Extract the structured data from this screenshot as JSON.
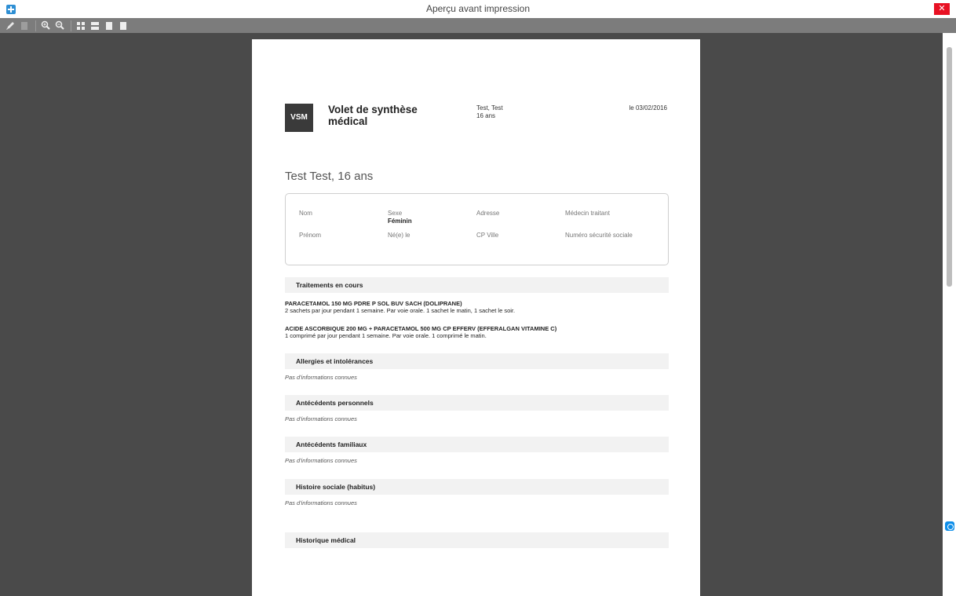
{
  "window": {
    "title": "Aperçu avant impression",
    "close_glyph": "✕"
  },
  "toolbar": {
    "buttons": [
      "pencil-icon",
      "copy-icon",
      "zoom-in-icon",
      "zoom-out-icon",
      "whole-page-icon",
      "page-width-icon",
      "two-pages-icon",
      "single-page-icon"
    ]
  },
  "document": {
    "badge": "VSM",
    "title": "Volet de synthèse médical",
    "patient_name": "Test, Test",
    "patient_age": "16 ans",
    "date": "le 03/02/2016",
    "patient_heading": "Test Test, 16 ans",
    "identity": {
      "nom_label": "Nom",
      "sexe_label": "Sexe",
      "sexe_value": "Féminin",
      "adresse_label": "Adresse",
      "medecin_label": "Médecin traitant",
      "prenom_label": "Prénom",
      "ne_le_label": "Né(e) le",
      "cp_ville_label": "CP Ville",
      "nss_label": "Numéro sécurité sociale"
    },
    "sections": {
      "traitements": {
        "title": "Traitements en cours",
        "meds": [
          {
            "name": "PARACETAMOL 150 mg pdre p sol buv sach (DOLIPRANE)",
            "dosage": "2 sachets par jour pendant 1 semaine. Par voie orale. 1 sachet le matin, 1 sachet le soir."
          },
          {
            "name": "ACIDE ASCORBIQUE 200 mg  +  PARACETAMOL 500 mg cp efferv (EFFERALGAN VITAMINE C)",
            "dosage": "1 comprimé par jour pendant 1 semaine. Par voie orale. 1 comprimé le matin."
          }
        ]
      },
      "allergies": {
        "title": "Allergies et intolérances",
        "empty": "Pas d'informations connues"
      },
      "antecedents_perso": {
        "title": "Antécédents personnels",
        "empty": "Pas d'informations connues"
      },
      "antecedents_fam": {
        "title": "Antécédents familiaux",
        "empty": "Pas d'informations connues"
      },
      "histoire_sociale": {
        "title": "Histoire sociale (habitus)",
        "empty": "Pas d'informations connues"
      },
      "historique": {
        "title": "Historique médical"
      }
    }
  }
}
